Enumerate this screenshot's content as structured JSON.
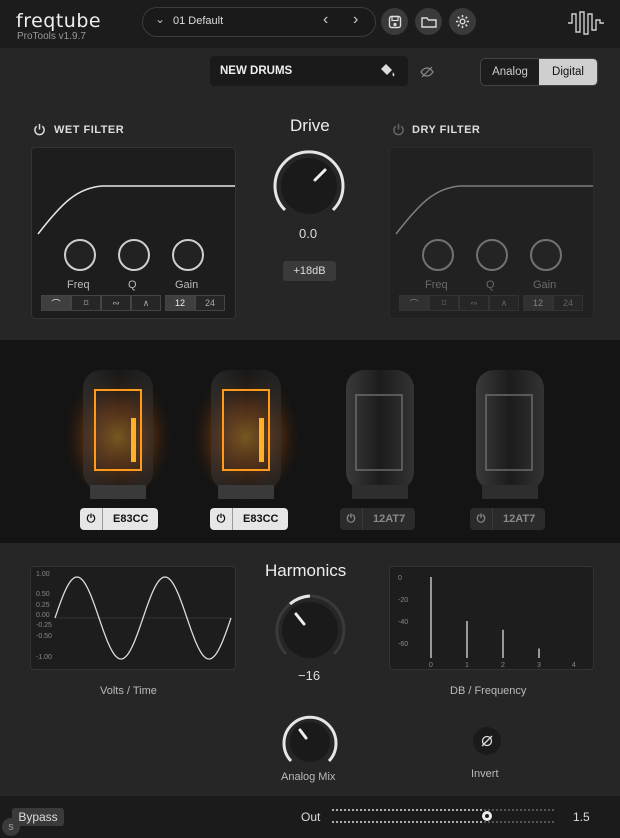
{
  "brand": {
    "name": "freqtube",
    "version": "ProTools v1.9.7"
  },
  "preset": {
    "name": "01 Default"
  },
  "instance_name": "NEW DRUMS",
  "mode": {
    "options": [
      "Analog",
      "Digital"
    ],
    "selected": "Digital"
  },
  "wet_filter": {
    "title": "WET FILTER",
    "knobs": [
      "Freq",
      "Q",
      "Gain"
    ],
    "slopes": [
      "12",
      "24"
    ],
    "selected_slope": "12"
  },
  "dry_filter": {
    "title": "DRY FILTER",
    "knobs": [
      "Freq",
      "Q",
      "Gain"
    ],
    "slopes": [
      "12",
      "24"
    ],
    "selected_slope": "12"
  },
  "drive": {
    "title": "Drive",
    "value": "0.0",
    "range_button": "+18dB"
  },
  "tubes": [
    {
      "name": "E83CC",
      "active": true
    },
    {
      "name": "E83CC",
      "active": true
    },
    {
      "name": "12AT7",
      "active": false
    },
    {
      "name": "12AT7",
      "active": false
    }
  ],
  "harmonics": {
    "title": "Harmonics",
    "value": "−16"
  },
  "scope": {
    "caption": "Volts / Time",
    "y_ticks": [
      "1.00",
      "0.50",
      "0.25",
      "0.00",
      "-0.25",
      "-0.50",
      "-1.00"
    ]
  },
  "spectrum": {
    "caption": "DB / Frequency",
    "y_ticks": [
      "0",
      "-20",
      "-40",
      "-60"
    ],
    "x_ticks": [
      "0",
      "1",
      "2",
      "3",
      "4"
    ],
    "bars": [
      0,
      -40,
      -48,
      -65
    ]
  },
  "analog_mix": {
    "label": "Analog Mix"
  },
  "invert": {
    "label": "Invert",
    "icon": "phase-invert-icon"
  },
  "footer": {
    "bypass": "Bypass",
    "out_label": "Out",
    "out_value": "1.5"
  },
  "colors": {
    "accent": "#e0e0e0",
    "tube_glow": "#ff9a1a",
    "bg": "#262626"
  }
}
